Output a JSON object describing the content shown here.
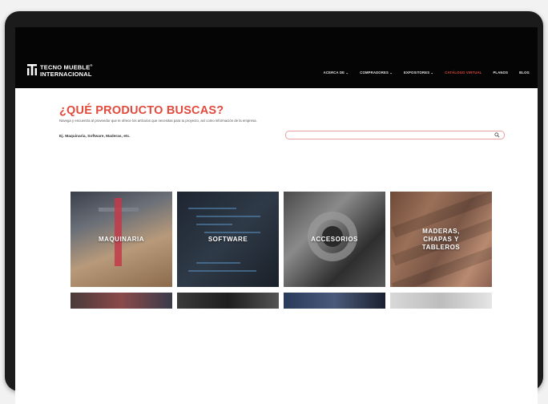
{
  "brand": {
    "line1": "TECNO MUEBLE",
    "reg": "®",
    "line2": "INTERNACIONAL"
  },
  "nav": {
    "items": [
      {
        "label": "ACERCA DE ⌄"
      },
      {
        "label": "COMPRADORES ⌄"
      },
      {
        "label": "EXPOSITORES ⌄"
      },
      {
        "label": "CATÁLOGO VIRTUAL"
      },
      {
        "label": "PLANOS"
      },
      {
        "label": "BLOG"
      }
    ],
    "active_index": 3
  },
  "hero": {
    "title": "¿QUÉ PRODUCTO BUSCAS?",
    "description": "Navega y encuentra al proveedor que te ofrece los artículos que necesitas para tu proyecto, así como información de la empresa.",
    "examples": "Ej. Maquinaria, Software, Maderas, etc."
  },
  "search": {
    "value": "",
    "placeholder": "",
    "icon": "search-icon"
  },
  "categories": [
    {
      "label": "MAQUINARIA"
    },
    {
      "label": "SOFTWARE"
    },
    {
      "label": "ACCESORIOS"
    },
    {
      "label": "MADERAS, CHAPAS Y TABLEROS"
    }
  ],
  "colors": {
    "accent": "#e14a3c",
    "nav_bg": "#050505",
    "page_bg": "#ffffff"
  }
}
